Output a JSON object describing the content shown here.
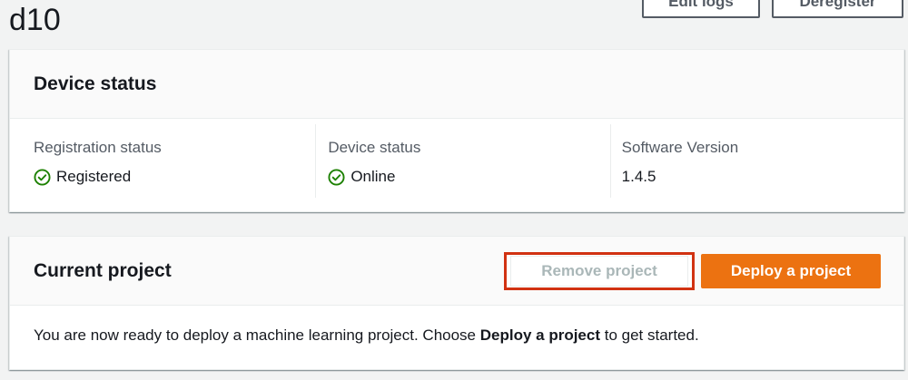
{
  "header": {
    "title": "d10",
    "edit_logs_label": "Edit logs",
    "deregister_label": "Deregister"
  },
  "device_status_card": {
    "title": "Device status",
    "columns": [
      {
        "label": "Registration status",
        "value": "Registered",
        "icon": "check-circle-icon"
      },
      {
        "label": "Device status",
        "value": "Online",
        "icon": "check-circle-icon"
      },
      {
        "label": "Software Version",
        "value": "1.4.5"
      }
    ]
  },
  "current_project_card": {
    "title": "Current project",
    "remove_label": "Remove project",
    "deploy_label": "Deploy a project",
    "message_prefix": "You are now ready to deploy a machine learning project. Choose ",
    "message_bold": "Deploy a project",
    "message_suffix": " to get started."
  },
  "colors": {
    "accent_orange": "#ec7211",
    "highlight_red": "#d13212",
    "success_green": "#1d8102",
    "text_primary": "#16191f",
    "text_secondary": "#545b64"
  }
}
